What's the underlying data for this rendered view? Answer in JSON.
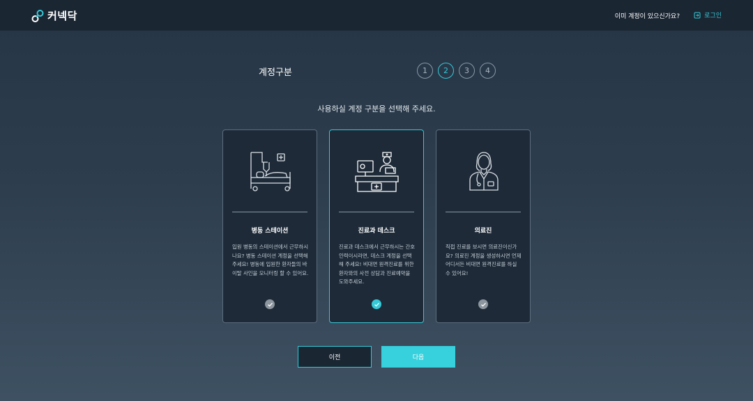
{
  "header": {
    "brand": "커넥닥",
    "have_account": "이미 계정이 있으신가요?",
    "login_label": "로그인"
  },
  "step_title": "계정구분",
  "steps": [
    "1",
    "2",
    "3",
    "4"
  ],
  "current_step": 2,
  "subtitle": "사용하실 계정 구분을 선택해 주세요.",
  "cards": [
    {
      "title": "병동 스테이션",
      "desc": "입원 병동의 스테이션에서 근무하시나요? 병동 스테이션 계정을 선택해 주세요! 병동에 입원한 환자들의 바이탈 사인을 모니터링 할 수 있어요.",
      "icon": "hospital-bed-icon",
      "selected": false
    },
    {
      "title": "진료과 데스크",
      "desc": "진료과 데스크에서 근무하시는 간호 인력이시라면, 데스크 계정을 선택해 주세요! 비대면 원격진료를 위한 환자와의 사전 상담과 진료예약을 도와주세요.",
      "icon": "nurse-desk-icon",
      "selected": true
    },
    {
      "title": "의료진",
      "desc": "직접 진료를 보시면 의료진이신가요? 의료진 계정을 생성하시면 언제 어디서든 비대면 원격진료를 하실 수 있어요!",
      "icon": "doctor-icon",
      "selected": false
    }
  ],
  "buttons": {
    "prev": "이전",
    "next": "다음"
  },
  "colors": {
    "accent": "#36c9d7",
    "header_bg": "#1b2633",
    "card_bg": "#1e2a38",
    "check_inactive": "#8d959d"
  }
}
